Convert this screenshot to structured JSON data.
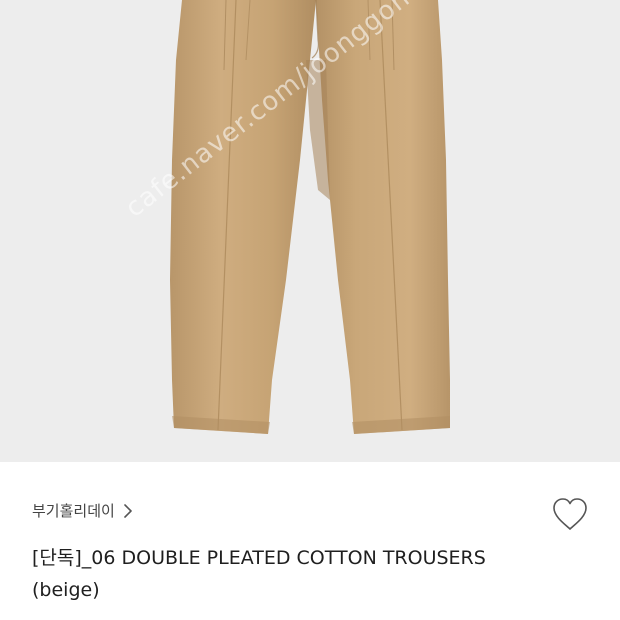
{
  "product": {
    "image_alt_icon": "beige-pleated-trousers",
    "watermark": "cafe.naver.com/joonggonara",
    "shop_name": "부기홀리데이",
    "title": "[단독]_06 DOUBLE PLEATED COTTON TROUSERS (beige)"
  },
  "icons": {
    "shop_chevron": "chevron-right-icon",
    "like": "heart-outline-icon"
  },
  "colors": {
    "image_background": "#ededed",
    "trousers": "#c9a677",
    "text_primary": "#1f1f1f",
    "text_secondary": "#444444"
  }
}
